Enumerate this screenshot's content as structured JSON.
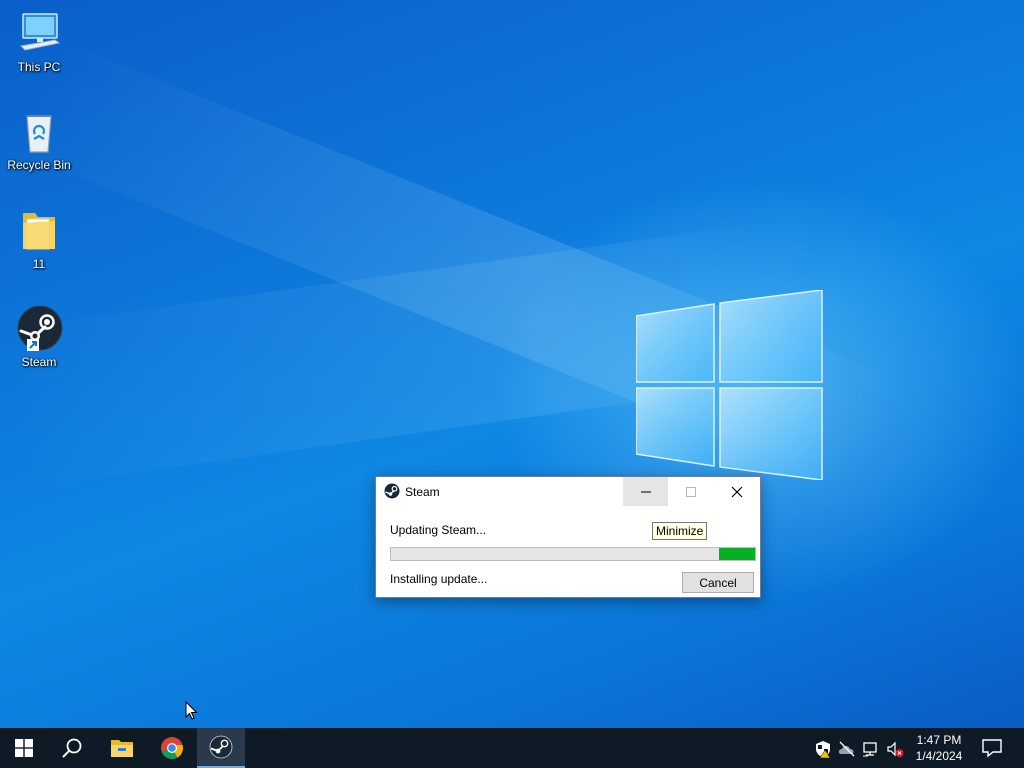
{
  "desktop": {
    "icons": [
      {
        "label": "This PC",
        "icon": "this-pc-icon"
      },
      {
        "label": "Recycle Bin",
        "icon": "recycle-bin-icon"
      },
      {
        "label": "11",
        "icon": "folder-icon"
      },
      {
        "label": "Steam",
        "icon": "steam-icon"
      }
    ]
  },
  "dialog": {
    "title": "Steam",
    "status": "Updating Steam...",
    "detail": "Installing update...",
    "cancel_label": "Cancel",
    "tooltip": "Minimize",
    "progress_fraction": 0.1
  },
  "taskbar": {
    "items": [
      "start-icon",
      "search-icon",
      "file-explorer-icon",
      "chrome-icon",
      "steam-icon"
    ],
    "time": "1:47 PM",
    "date": "1/4/2024"
  },
  "colors": {
    "progress_fill": "#06b025",
    "taskbar_bg": "#0e1a26",
    "wallpaper_blue": "#0d74d8"
  }
}
